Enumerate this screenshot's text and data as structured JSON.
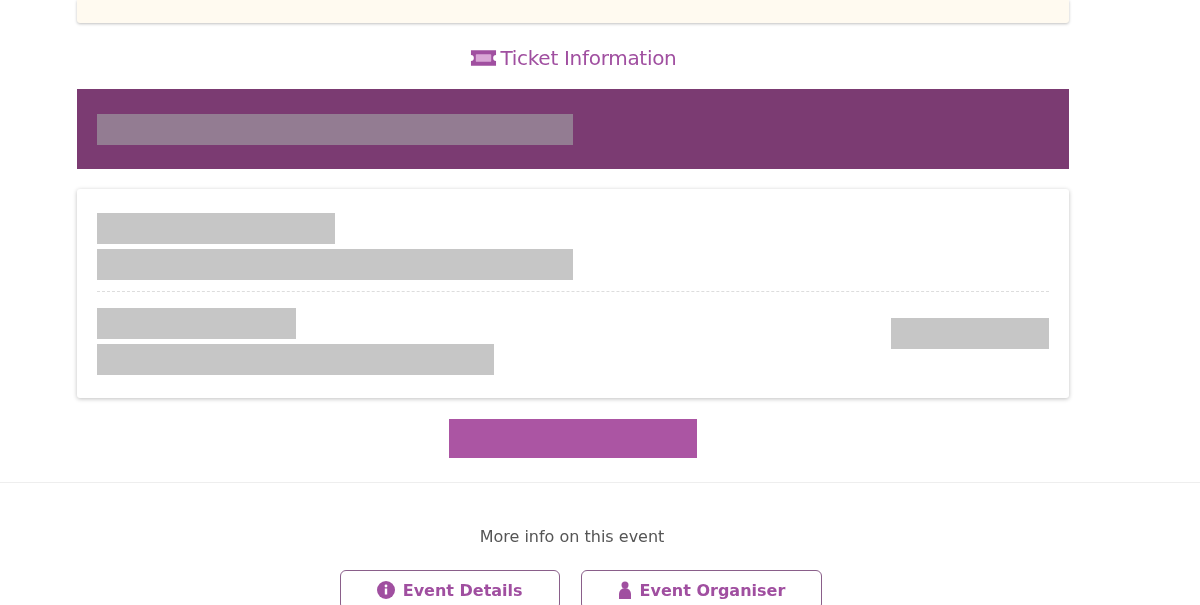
{
  "notice_panel": {
    "kind": "notice"
  },
  "ticket_section": {
    "heading": "Ticket Information",
    "loading": true
  },
  "more_info": {
    "text": "More info on this event",
    "buttons": [
      {
        "label": "Event Details",
        "kind": "info"
      },
      {
        "label": "Event Organiser",
        "kind": "person"
      }
    ]
  }
}
